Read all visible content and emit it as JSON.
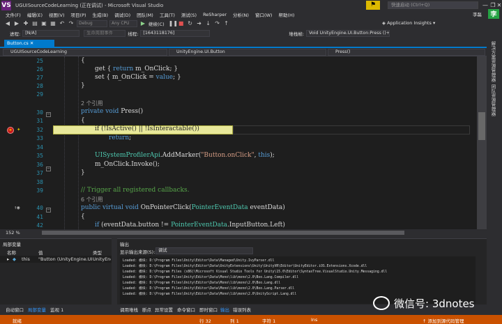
{
  "window": {
    "title": "UGUISourceCodeLearning (正在调试) - Microsoft Visual Studio",
    "logo": "VS",
    "quick_launch_placeholder": "快速启动 (Ctrl+Q)",
    "notify_icon": "notification-bell-icon",
    "controls": [
      "—",
      "❐",
      "✕"
    ]
  },
  "menu": {
    "items": [
      "文件(F)",
      "编辑(E)",
      "视图(V)",
      "项目(P)",
      "生成(B)",
      "调试(D)",
      "团队(M)",
      "工具(T)",
      "测试(S)",
      "ReSharper",
      "分析(N)",
      "窗口(W)",
      "帮助(H)"
    ],
    "user_name": "李磊",
    "user_avatar": "李"
  },
  "toolbar": {
    "config": "Debug",
    "platform": "Any CPU",
    "continue_label": "继续(C)",
    "app_insights": "Application Insights"
  },
  "debug_location": {
    "process_label": "进程:",
    "process_value": "[N/A]",
    "lifecycle_label": "生命周期事件",
    "thread_label": "线程:",
    "thread_value": "[1643118176]",
    "stack_label": "堆栈帧:",
    "stack_value": "Void UnityEngine.UI.Button:Press ()+0x"
  },
  "editor": {
    "tab_label": "Button.cs  ✕",
    "nav": {
      "project": "UGUISourceCodeLearning",
      "class": "UnityEngine.UI.Button",
      "member": "Press()"
    },
    "zoom": "152 %",
    "line_numbers": [
      "25",
      "26",
      "27",
      "28",
      "29",
      "30",
      "31",
      "32",
      "33",
      "34",
      "35",
      "36",
      "37",
      "38",
      "39",
      "40",
      "41",
      "42"
    ],
    "refs_2": "2 个引用",
    "refs_6": "6 个引用",
    "code": {
      "l25": "{",
      "l26_a": "get { ",
      "l26_kw": "return",
      "l26_b": " m_OnClick; }",
      "l27_a": "set { m_OnClick = ",
      "l27_kw": "value",
      "l27_b": "; }",
      "l28": "}",
      "l30_kw": "private void",
      "l30_b": " Press()",
      "l31": "{",
      "l32": "if (!IsActive() || !IsInteractable())",
      "l33_kw": "return",
      "l33_b": ";",
      "l35_ty": "UISystemProfilerApi",
      "l35_a": ".AddMarker(",
      "l35_st": "\"Button.onClick\"",
      "l35_b": ", ",
      "l35_kw": "this",
      "l35_c": ");",
      "l36": "m_OnClick.Invoke();",
      "l37": "}",
      "l39": "// Trigger all registered callbacks.",
      "l40_kw": "public virtual void",
      "l40_a": " OnPointerClick(",
      "l40_ty": "PointerEventData",
      "l40_b": " eventData)",
      "l41": "{",
      "l42_kw": "if",
      "l42_a": " (eventData.button != ",
      "l42_ty": "PointerEventData",
      "l42_b": ".InputButton.Left)"
    }
  },
  "locals": {
    "title": "局部变量",
    "col_name": "名称",
    "col_value": "值",
    "col_type": "类型",
    "row_name": "this",
    "row_value": "\"Button (UnityEngine.UI.Butt",
    "row_type": "UnityEng"
  },
  "output": {
    "title": "输出",
    "source_label": "显示输出来源(S):",
    "source_value": "调试",
    "lines": [
      "Loaded: 模块: D:\\Program Files\\Unity\\Editor\\Data\\Managed\\Unity.IvyParser.dll",
      "Loaded: 模块: D:\\Program Files\\Unity\\Editor\\Data\\UnityExtensions\\Unity\\UnityVR\\Editor\\UnityEditor.iOS.Extensions.Xcode.dll",
      "Loaded: 模块: D:\\Program Files (x86)\\Microsoft Visual Studio Tools for Unity\\15.0\\Editor\\SyntaxTree.VisualStudio.Unity.Messaging.dll",
      "Loaded: 模块: D:\\Program Files\\Unity\\Editor\\Data\\Mono\\lib\\mono\\2.0\\Boo.Lang.Compiler.dll",
      "Loaded: 模块: D:\\Program Files\\Unity\\Editor\\Data\\Mono\\lib\\mono\\2.0\\Boo.Lang.dll",
      "Loaded: 模块: D:\\Program Files\\Unity\\Editor\\Data\\Mono\\lib\\mono\\2.0\\Boo.Lang.Parser.dll",
      "Loaded: 模块: D:\\Program Files\\Unity\\Editor\\Data\\Mono\\lib\\mono\\2.0\\UnityScript.Lang.dll"
    ]
  },
  "bottom_tabs": {
    "left": [
      "自动窗口",
      "局部变量",
      "监视 1"
    ],
    "right": [
      "调用堆栈",
      "断点",
      "异常设置",
      "命令窗口",
      "即时窗口",
      "输出",
      "错误列表"
    ]
  },
  "right_strip": {
    "labels": [
      "解决方案资源管理器",
      "团队资源管理器"
    ]
  },
  "status": {
    "ready": "就绪",
    "line": "行 32",
    "col": "列 1",
    "char": "字符 1",
    "mode": "Ins",
    "source_control": "↑ 添加到源代码管理"
  },
  "watermark": {
    "text": "微信号: 3dnotes"
  },
  "colors": {
    "accent": "#007acc",
    "status_bar": "#ca5100",
    "breakpoint": "#c51a1a",
    "highlight": "#e8e89a"
  }
}
